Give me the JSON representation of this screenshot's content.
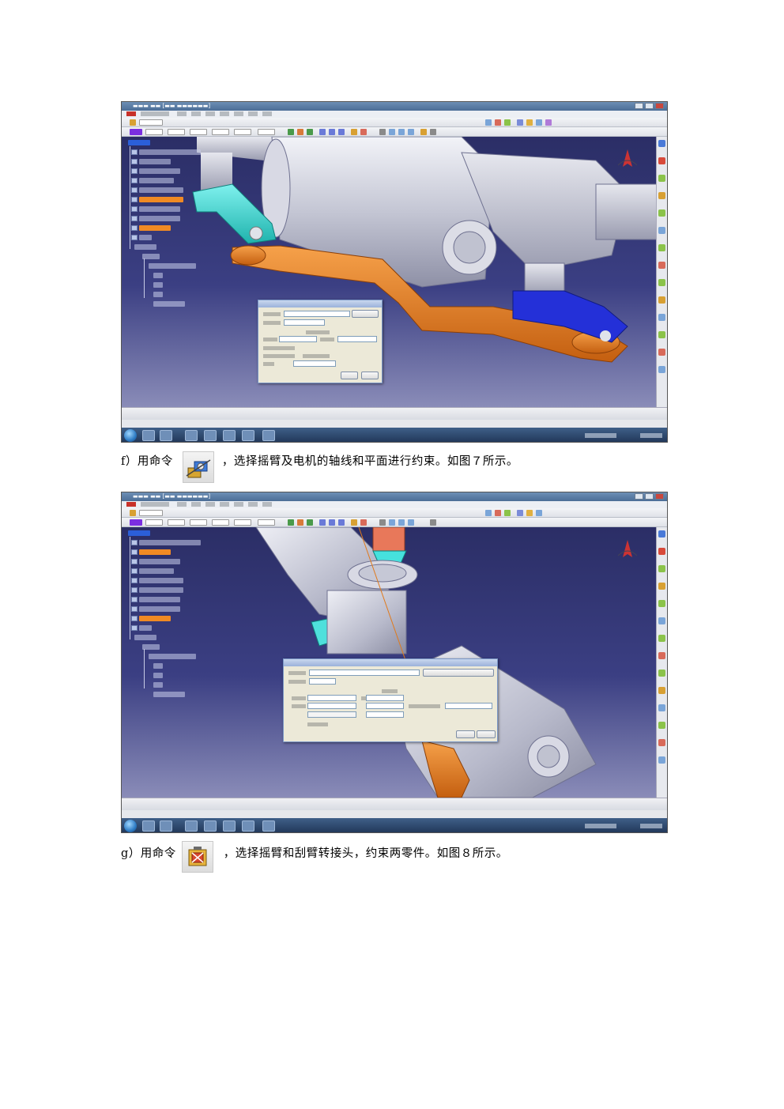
{
  "caption_f": {
    "lead": "f）用命令",
    "icon": "coincidence-constraint-icon",
    "text": "，选择摇臂及电机的轴线和平面进行约束。如图７所示。"
  },
  "caption_g": {
    "lead": "g）用命令",
    "icon": "fix-together-constraint-icon",
    "text": "，选择摇臂和刮臂转接头，约束两零件。如图８所示。"
  },
  "colors": {
    "viewport_bg": "#2f3370",
    "rocker_arm": "#3fd3cf",
    "link_rod": "#e07a1c",
    "bracket": "#2430d8",
    "motor": "#c7c9d6",
    "tree_highlight": "#f08a24",
    "tree_selected": "#2b5fd9"
  }
}
